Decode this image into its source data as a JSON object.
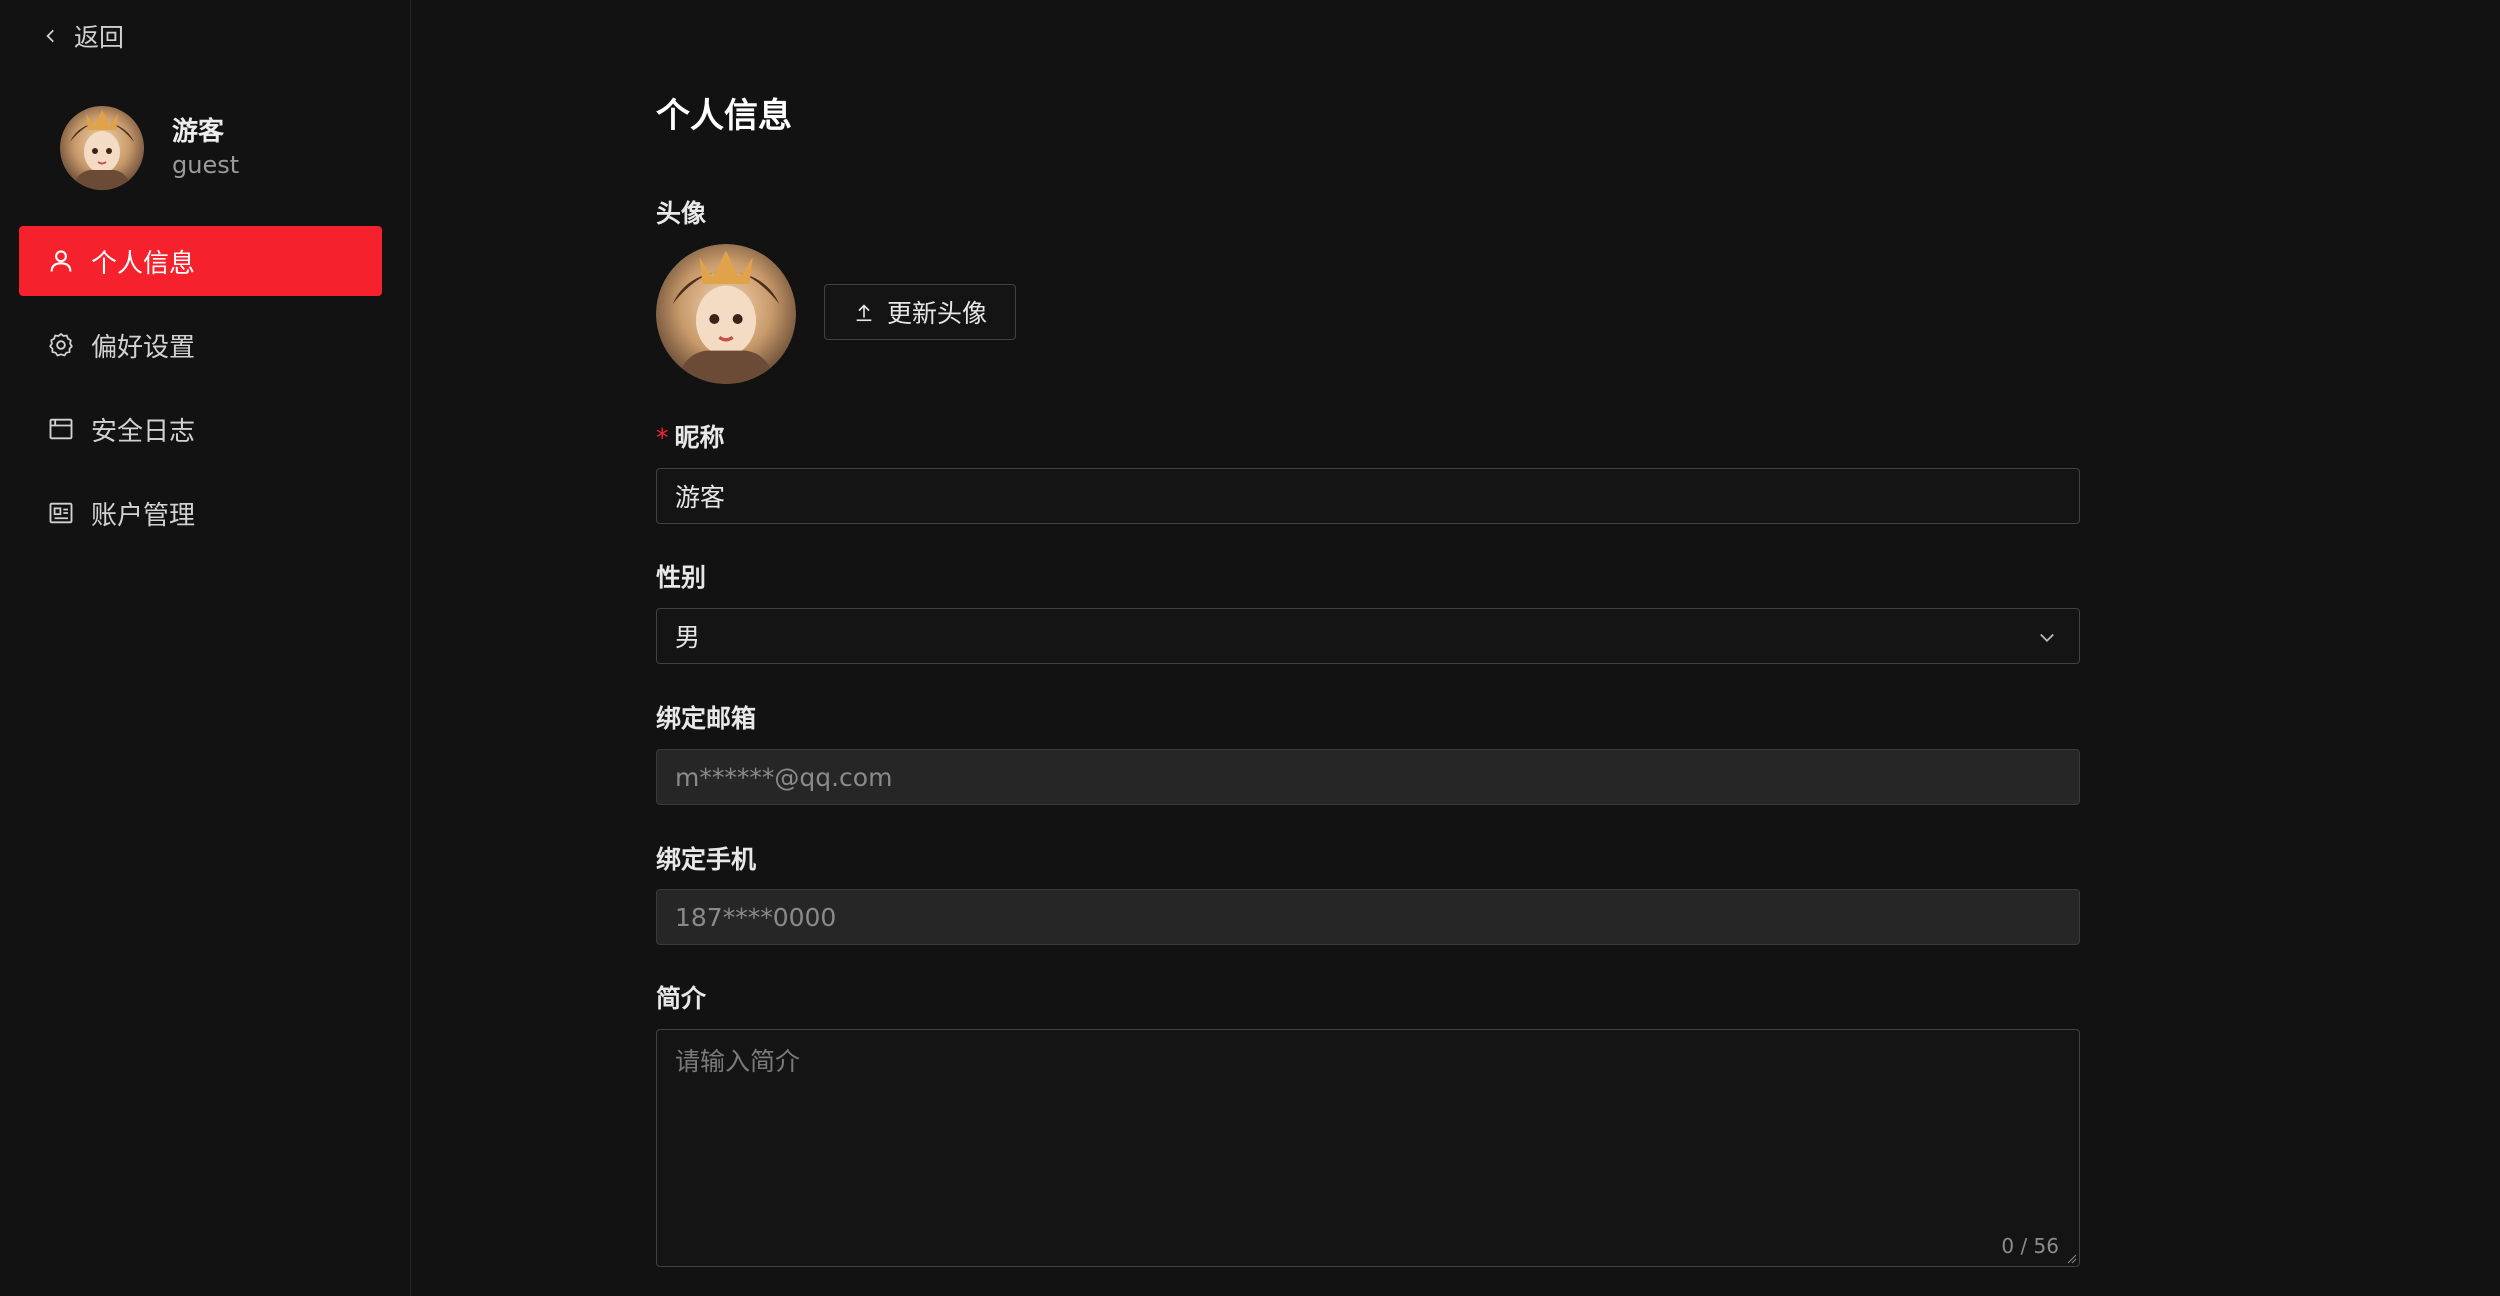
{
  "sidebar": {
    "back_label": "返回",
    "user": {
      "name": "游客",
      "handle": "guest"
    },
    "items": [
      {
        "label": "个人信息",
        "icon": "user-icon",
        "active": true
      },
      {
        "label": "偏好设置",
        "icon": "gear-icon",
        "active": false
      },
      {
        "label": "安全日志",
        "icon": "browser-window-icon",
        "active": false
      },
      {
        "label": "账户管理",
        "icon": "id-card-icon",
        "active": false
      }
    ]
  },
  "main": {
    "title": "个人信息",
    "avatar": {
      "label": "头像",
      "upload_label": "更新头像"
    },
    "nickname": {
      "label": "昵称",
      "required_mark": "*",
      "value": "游客"
    },
    "gender": {
      "label": "性别",
      "value": "男"
    },
    "email": {
      "label": "绑定邮箱",
      "value": "m******@qq.com"
    },
    "phone": {
      "label": "绑定手机",
      "value": "187****0000"
    },
    "bio": {
      "label": "简介",
      "placeholder": "请输入简介",
      "counter": "0 / 56"
    }
  },
  "colors": {
    "accent": "#f5222d",
    "background": "#121212",
    "border": "#434343"
  }
}
